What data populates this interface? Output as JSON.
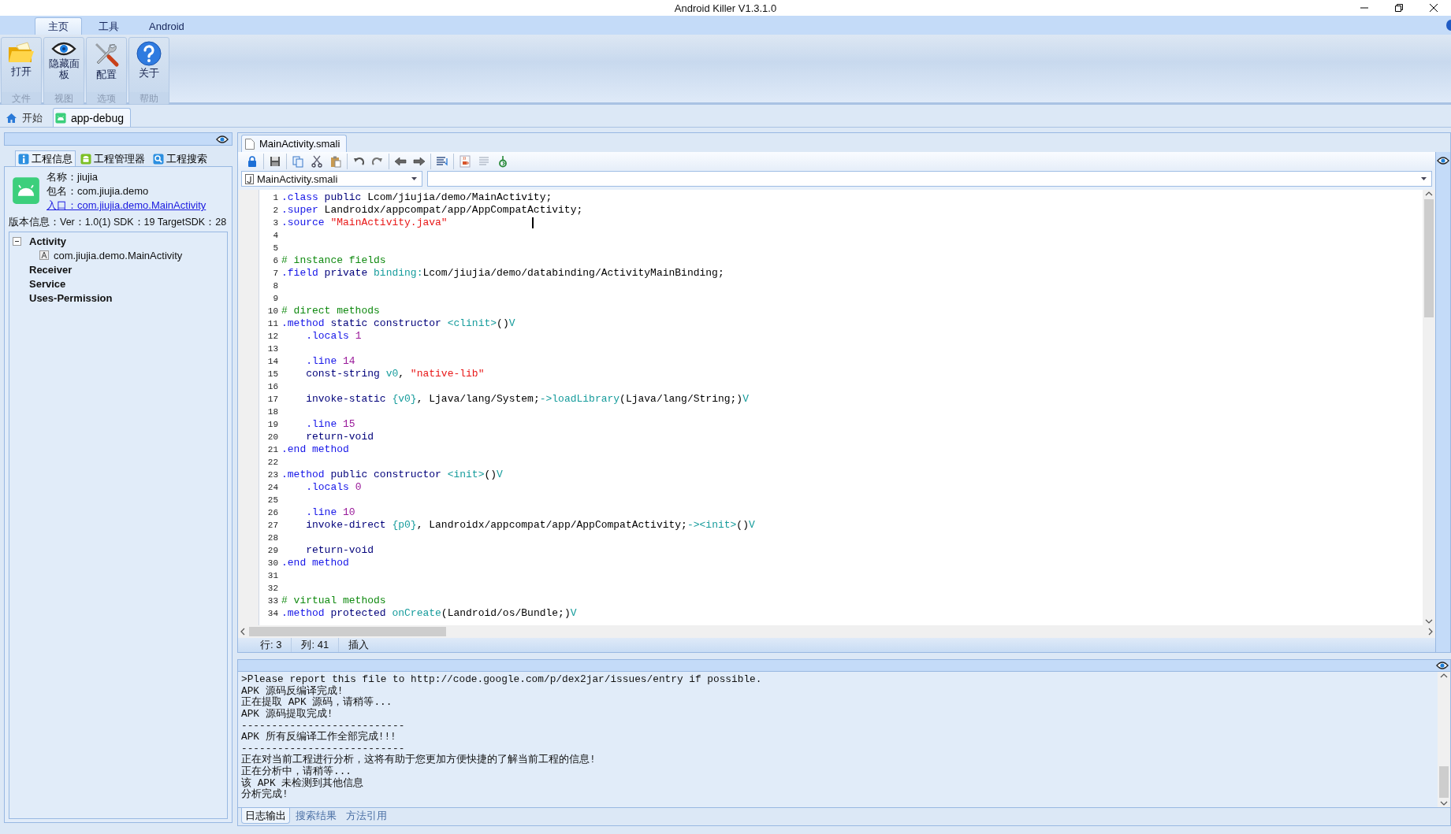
{
  "window": {
    "title": "Android Killer V1.3.1.0"
  },
  "ribbon": {
    "tabs": [
      {
        "label": "主页",
        "selected": true
      },
      {
        "label": "工具",
        "selected": false
      },
      {
        "label": "Android",
        "selected": false
      }
    ],
    "groups": [
      {
        "label": "文件",
        "button": "打开"
      },
      {
        "label": "视图",
        "button": "隐藏面板"
      },
      {
        "label": "选项",
        "button": "配置"
      },
      {
        "label": "帮助",
        "button": "关于"
      }
    ]
  },
  "document_tabs": [
    {
      "label": "开始",
      "selected": false
    },
    {
      "label": "app-debug",
      "selected": true
    }
  ],
  "project_panel": {
    "tabs": [
      {
        "label": "工程信息",
        "selected": true
      },
      {
        "label": "工程管理器",
        "selected": false
      },
      {
        "label": "工程搜索",
        "selected": false
      }
    ],
    "info": {
      "name": "名称：jiujia",
      "package": "包名：com.jiujia.demo",
      "entry": "入口：com.jiujia.demo.MainActivity",
      "version": "版本信息：Ver：1.0(1) SDK：19 TargetSDK：28"
    },
    "tree": [
      {
        "label": "Activity",
        "expanded": true,
        "children": [
          {
            "label": "com.jiujia.demo.MainActivity"
          }
        ]
      },
      {
        "label": "Receiver"
      },
      {
        "label": "Service"
      },
      {
        "label": "Uses-Permission"
      }
    ]
  },
  "editor": {
    "tabs": [
      {
        "label": "MainActivity.smali",
        "selected": true
      }
    ],
    "file_select": "MainActivity.smali",
    "lines": [
      {
        "number": "1",
        "tokens": [
          {
            "kind": "directive",
            "text": ".class "
          },
          {
            "kind": "keyword",
            "text": "public "
          },
          {
            "kind": "plain",
            "text": "Lcom/jiujia/demo/MainActivity;"
          }
        ]
      },
      {
        "number": "2",
        "tokens": [
          {
            "kind": "directive",
            "text": ".super "
          },
          {
            "kind": "plain",
            "text": "Landroidx/appcompat/app/AppCompatActivity;"
          }
        ]
      },
      {
        "number": "3",
        "tokens": [
          {
            "kind": "directive",
            "text": ".source "
          },
          {
            "kind": "string",
            "text": "\"MainActivity.java\""
          }
        ]
      },
      {
        "number": "4"
      },
      {
        "number": "5"
      },
      {
        "number": "6",
        "tokens": [
          {
            "kind": "comment",
            "text": "# instance fields"
          }
        ]
      },
      {
        "number": "7",
        "tokens": [
          {
            "kind": "directive",
            "text": ".field "
          },
          {
            "kind": "keyword",
            "text": "private "
          },
          {
            "kind": "reference",
            "text": "binding:"
          },
          {
            "kind": "plain",
            "text": "Lcom/jiujia/demo/databinding/ActivityMainBinding;"
          }
        ]
      },
      {
        "number": "8"
      },
      {
        "number": "9"
      },
      {
        "number": "10",
        "tokens": [
          {
            "kind": "comment",
            "text": "# direct methods"
          }
        ]
      },
      {
        "number": "11",
        "tokens": [
          {
            "kind": "directive",
            "text": ".method "
          },
          {
            "kind": "keyword",
            "text": "static constructor "
          },
          {
            "kind": "reference",
            "text": "<clinit>"
          },
          {
            "kind": "plain",
            "text": "()"
          },
          {
            "kind": "reference",
            "text": "V"
          }
        ]
      },
      {
        "number": "12",
        "tokens": [
          {
            "kind": "directive",
            "text": "    .locals "
          },
          {
            "kind": "number",
            "text": "1"
          }
        ]
      },
      {
        "number": "13"
      },
      {
        "number": "14",
        "tokens": [
          {
            "kind": "directive",
            "text": "    .line "
          },
          {
            "kind": "number",
            "text": "14"
          }
        ]
      },
      {
        "number": "15",
        "tokens": [
          {
            "kind": "keyword",
            "text": "    const-string "
          },
          {
            "kind": "reference",
            "text": "v0"
          },
          {
            "kind": "plain",
            "text": ", "
          },
          {
            "kind": "string",
            "text": "\"native-lib\""
          }
        ]
      },
      {
        "number": "16"
      },
      {
        "number": "17",
        "tokens": [
          {
            "kind": "keyword",
            "text": "    invoke-static "
          },
          {
            "kind": "reference",
            "text": "{v0}"
          },
          {
            "kind": "plain",
            "text": ", Ljava/lang/System;"
          },
          {
            "kind": "reference",
            "text": "->loadLibrary"
          },
          {
            "kind": "plain",
            "text": "(Ljava/lang/String;)"
          },
          {
            "kind": "reference",
            "text": "V"
          }
        ]
      },
      {
        "number": "18"
      },
      {
        "number": "19",
        "tokens": [
          {
            "kind": "directive",
            "text": "    .line "
          },
          {
            "kind": "number",
            "text": "15"
          }
        ]
      },
      {
        "number": "20",
        "tokens": [
          {
            "kind": "keyword",
            "text": "    return-void"
          }
        ]
      },
      {
        "number": "21",
        "tokens": [
          {
            "kind": "directive",
            "text": ".end method"
          }
        ]
      },
      {
        "number": "22"
      },
      {
        "number": "23",
        "tokens": [
          {
            "kind": "directive",
            "text": ".method "
          },
          {
            "kind": "keyword",
            "text": "public constructor "
          },
          {
            "kind": "reference",
            "text": "<init>"
          },
          {
            "kind": "plain",
            "text": "()"
          },
          {
            "kind": "reference",
            "text": "V"
          }
        ]
      },
      {
        "number": "24",
        "tokens": [
          {
            "kind": "directive",
            "text": "    .locals "
          },
          {
            "kind": "number",
            "text": "0"
          }
        ]
      },
      {
        "number": "25"
      },
      {
        "number": "26",
        "tokens": [
          {
            "kind": "directive",
            "text": "    .line "
          },
          {
            "kind": "number",
            "text": "10"
          }
        ]
      },
      {
        "number": "27",
        "tokens": [
          {
            "kind": "keyword",
            "text": "    invoke-direct "
          },
          {
            "kind": "reference",
            "text": "{p0}"
          },
          {
            "kind": "plain",
            "text": ", Landroidx/appcompat/app/AppCompatActivity;"
          },
          {
            "kind": "reference",
            "text": "-><init>"
          },
          {
            "kind": "plain",
            "text": "()"
          },
          {
            "kind": "reference",
            "text": "V"
          }
        ]
      },
      {
        "number": "28"
      },
      {
        "number": "29",
        "tokens": [
          {
            "kind": "keyword",
            "text": "    return-void"
          }
        ]
      },
      {
        "number": "30",
        "tokens": [
          {
            "kind": "directive",
            "text": ".end method"
          }
        ]
      },
      {
        "number": "31"
      },
      {
        "number": "32"
      },
      {
        "number": "33",
        "tokens": [
          {
            "kind": "comment",
            "text": "# virtual methods"
          }
        ]
      },
      {
        "number": "34",
        "tokens": [
          {
            "kind": "directive",
            "text": ".method "
          },
          {
            "kind": "keyword",
            "text": "protected "
          },
          {
            "kind": "reference",
            "text": "onCreate"
          },
          {
            "kind": "plain",
            "text": "(Landroid/os/Bundle;)"
          },
          {
            "kind": "reference",
            "text": "V"
          }
        ]
      }
    ],
    "status": {
      "row": "行: 3",
      "column": "列: 41",
      "mode": "插入"
    }
  },
  "output": {
    "lines": [
      ">Please report this file to http://code.google.com/p/dex2jar/issues/entry if possible.",
      "APK 源码反编译完成!",
      "正在提取 APK 源码，请稍等...",
      "APK 源码提取完成!",
      "---------------------------",
      "APK 所有反编译工作全部完成!!!",
      "---------------------------",
      "正在对当前工程进行分析，这将有助于您更加方便快捷的了解当前工程的信息!",
      "正在分析中，请稍等...",
      "该 APK 未检测到其他信息",
      "分析完成!"
    ],
    "tabs": [
      {
        "label": "日志输出",
        "selected": true
      },
      {
        "label": "搜索结果",
        "selected": false
      },
      {
        "label": "方法引用",
        "selected": false
      }
    ]
  }
}
